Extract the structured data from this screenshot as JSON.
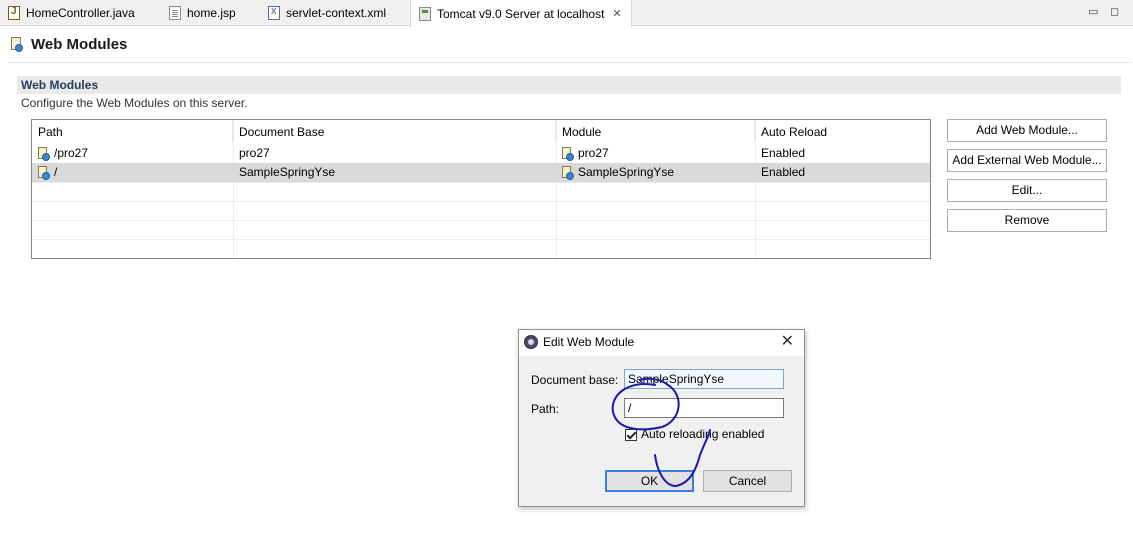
{
  "tabs": [
    {
      "label": "HomeController.java",
      "icon": "java-file-icon"
    },
    {
      "label": "home.jsp",
      "icon": "jsp-file-icon"
    },
    {
      "label": "servlet-context.xml",
      "icon": "xml-file-icon"
    },
    {
      "label": "Tomcat v9.0 Server at localhost",
      "icon": "server-icon",
      "active": true
    }
  ],
  "window_controls": {
    "minimize": "▭",
    "maximize": "◻"
  },
  "header": {
    "title": "Web Modules"
  },
  "section": {
    "title": "Web Modules",
    "description": "Configure the Web Modules on this server."
  },
  "table": {
    "columns": [
      "Path",
      "Document Base",
      "Module",
      "Auto Reload"
    ],
    "rows": [
      {
        "path": "/pro27",
        "document_base": "pro27",
        "module": "pro27",
        "auto_reload": "Enabled",
        "selected": false
      },
      {
        "path": "/",
        "document_base": "SampleSpringYse",
        "module": "SampleSpringYse",
        "auto_reload": "Enabled",
        "selected": true
      }
    ]
  },
  "buttons": {
    "add_web_module": "Add Web Module...",
    "add_external_web_module": "Add External Web Module...",
    "edit": "Edit...",
    "remove": "Remove"
  },
  "dialog": {
    "title": "Edit Web Module",
    "close": "✕",
    "document_base_label": "Document base:",
    "document_base_value": "SampleSpringYse",
    "path_label": "Path:",
    "path_value": "/",
    "auto_reload_label": "Auto reloading enabled",
    "auto_reload_checked": true,
    "ok": "OK",
    "cancel": "Cancel"
  },
  "colors": {
    "selection": "#d9d9d9",
    "section_bar": "#e9e9e9",
    "default_button_border": "#3c7fd6",
    "annotation_ink": "#1a1aa8"
  }
}
